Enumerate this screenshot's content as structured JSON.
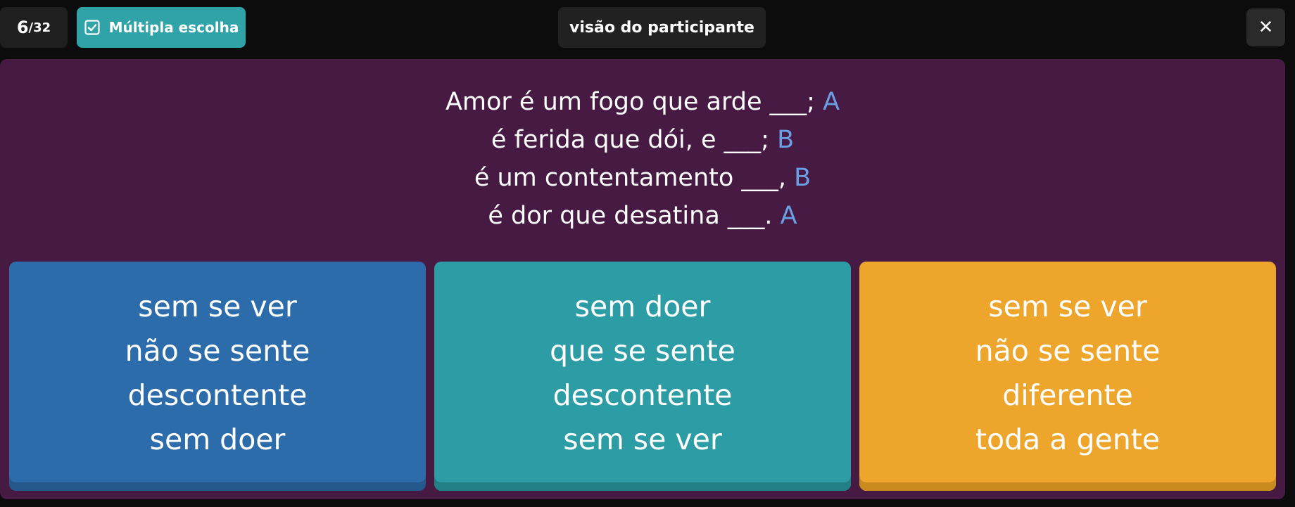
{
  "header": {
    "counter_current": "6",
    "counter_total": "/32",
    "type_badge": "Múltipla escolha",
    "view_label": "visão do participante",
    "close_label": "✕"
  },
  "question": {
    "lines": [
      {
        "text": "Amor é um fogo que arde ___;",
        "tag": " A"
      },
      {
        "text": "é ferida que dói, e ___;",
        "tag": " B"
      },
      {
        "text": "é um contentamento ___,",
        "tag": " B"
      },
      {
        "text": "é dor que desatina ___.",
        "tag": " A"
      }
    ]
  },
  "options": [
    {
      "lines": [
        "sem se ver",
        "não se sente",
        "descontente",
        "sem doer"
      ]
    },
    {
      "lines": [
        "sem doer",
        "que se sente",
        "descontente",
        "sem se ver"
      ]
    },
    {
      "lines": [
        "sem se ver",
        "não se sente",
        "diferente",
        "toda a gente"
      ]
    }
  ],
  "colors": {
    "stage": "#461a42",
    "option_blue": "#2d6cab",
    "option_teal": "#2d9da5",
    "option_yellow": "#eda52b",
    "badge_teal": "#2fa3a7",
    "blank_tag": "#6a9fe6"
  },
  "icons": {
    "type_badge": "checkbox-checked-icon",
    "close": "close-icon"
  }
}
